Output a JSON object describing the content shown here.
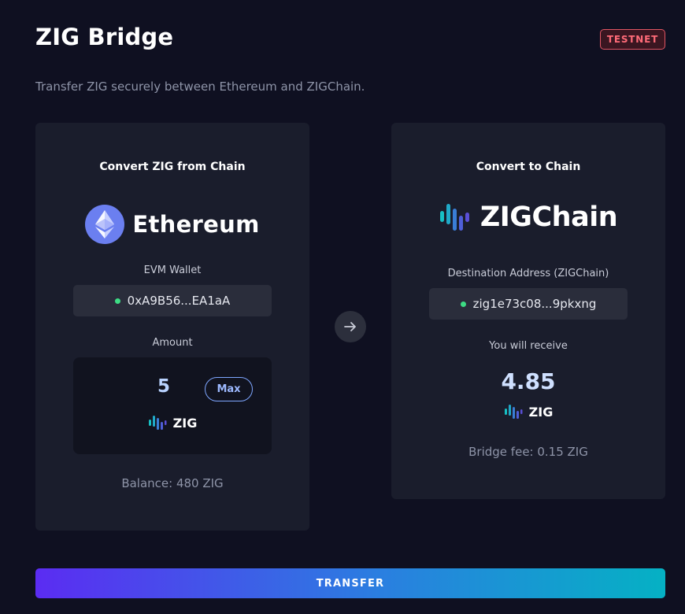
{
  "header": {
    "title": "ZIG Bridge",
    "badge": "TESTNET",
    "subtitle": "Transfer ZIG securely between Ethereum and ZIGChain."
  },
  "source": {
    "heading": "Convert ZIG from Chain",
    "chain_name": "Ethereum",
    "chain_icon": "ethereum-logo-icon",
    "wallet_label": "EVM Wallet",
    "wallet_address": "0xA9B56...EA1aA",
    "amount_label": "Amount",
    "amount_value": "5",
    "max_label": "Max",
    "token": "ZIG",
    "token_icon": "zig-logo-icon",
    "balance": "Balance: 480 ZIG"
  },
  "destination": {
    "heading": "Convert to Chain",
    "chain_name": "ZIGChain",
    "chain_icon": "zigchain-logo-icon",
    "address_label": "Destination Address (ZIGChain)",
    "address": "zig1e73c08...9pkxng",
    "receive_label": "You will receive",
    "receive_value": "4.85",
    "token": "ZIG",
    "fee": "Bridge fee: 0.15 ZIG"
  },
  "arrow_icon": "arrow-right-icon",
  "transfer_label": "TRANSFER",
  "colors": {
    "background": "#0f1021",
    "card": "#1a1d2c",
    "badge_red": "#ff6b78",
    "status_green": "#3ddc84",
    "gradient_start": "#5b2cf2",
    "gradient_end": "#05b1c4"
  }
}
